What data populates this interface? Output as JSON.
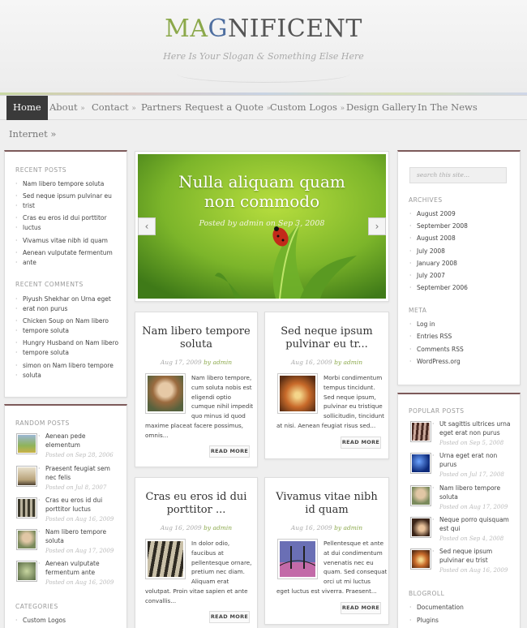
{
  "site": {
    "logo_part1": "MA",
    "logo_part2": "G",
    "logo_part3": "NIFICENT",
    "slogan": "Here Is Your Slogan & Something Else Here"
  },
  "nav": {
    "items": [
      {
        "label": "Home"
      },
      {
        "label": "About",
        "arrow": "»"
      },
      {
        "label": "Contact",
        "arrow": "»"
      },
      {
        "label": "Partners"
      },
      {
        "label": "Request a Quote",
        "arrow": "»"
      },
      {
        "label": "Custom Logos",
        "arrow": "»"
      },
      {
        "label": "Design Gallery"
      },
      {
        "label": "In The News"
      }
    ],
    "second_row": "Internet »"
  },
  "left_sidebar": {
    "recent_posts_title": "RECENT POSTS",
    "recent_posts": [
      "Nam libero tempore soluta",
      "Sed neque ipsum pulvinar eu",
      "trist",
      "Cras eu eros id dui porttitor",
      "luctus",
      "Vivamus vitae nibh id quam",
      "Aenean vulputate fermentum",
      "ante"
    ],
    "recent_comments_title": "RECENT COMMENTS",
    "recent_comments": [
      "Piyush Shekhar on Urna eget",
      "erat non purus",
      "Chicken Soup on Nam libero",
      "tempore soluta",
      "Hungry Husband on Nam libero",
      "tempore soluta",
      "simon on Nam libero tempore",
      "soluta"
    ],
    "random_posts_title": "RANDOM POSTS",
    "random_posts": [
      {
        "title1": "Aenean pede",
        "title2": "elementum",
        "date": "Posted on Sep 28, 2006"
      },
      {
        "title1": "Praesent feugiat sem",
        "title2": "nec felis",
        "date": "Posted on Jul 8, 2007"
      },
      {
        "title1": "Cras eu eros id dui",
        "title2": "porttitor luctus",
        "date": "Posted on Aug 16, 2009"
      },
      {
        "title1": "Nam libero tempore",
        "title2": "soluta",
        "date": "Posted on Aug 17, 2009"
      },
      {
        "title1": "Aenean vulputate",
        "title2": "fermentum ante",
        "date": "Posted on Aug 16, 2009"
      }
    ],
    "categories_title": "CATEGORIES",
    "categories": [
      "Custom Logos"
    ]
  },
  "featured": {
    "title_line1": "Nulla aliquam quam",
    "title_line2": "non commodo",
    "meta": "Posted by admin on Sep 3, 2008",
    "prev": "‹",
    "next": "›"
  },
  "posts": [
    {
      "title1": "Nam libero tempore",
      "title2": "soluta",
      "date": "Aug 17, 2009",
      "by": "by",
      "author": "admin",
      "text": [
        "Nam libero tempore,",
        "cum soluta nobis est",
        "eligendi optio",
        "cumque nihil impedit",
        "quo minus id quod"
      ],
      "text_wide": [
        "maxime placeat facere possimus,",
        "omnis..."
      ],
      "more": "READ MORE"
    },
    {
      "title1": "Sed neque ipsum",
      "title2": "pulvinar eu tr...",
      "date": "Aug 16, 2009",
      "by": "by",
      "author": "admin",
      "text": [
        "Morbi condimentum",
        "tempus tincidunt.",
        "Sed neque ipsum,",
        "pulvinar eu tristique",
        "sollicitudin, tincidunt"
      ],
      "text_wide": [
        "at nisi. Aenean feugiat risus sed..."
      ],
      "more": "READ MORE"
    },
    {
      "title1": "Cras eu eros id dui",
      "title2": "porttitor ...",
      "date": "Aug 16, 2009",
      "by": "by",
      "author": "admin",
      "text": [
        "In dolor odio,",
        "faucibus at",
        "pellentesque ornare,",
        "pretium nec diam.",
        "Aliquam erat"
      ],
      "text_wide": [
        "volutpat. Proin vitae sapien et ante",
        "convallis..."
      ],
      "more": "READ MORE"
    },
    {
      "title1": "Vivamus vitae nibh",
      "title2": "id quam",
      "date": "Aug 16, 2009",
      "by": "by",
      "author": "admin",
      "text": [
        "Pellentesque et ante",
        "at dui condimentum",
        "venenatis nec eu",
        "quam. Sed consequat",
        "orci ut mi luctus"
      ],
      "text_wide": [
        "eget luctus est viverra. Praesent..."
      ],
      "more": "READ MORE"
    }
  ],
  "right_sidebar": {
    "search_placeholder": "search this site...",
    "archives_title": "ARCHIVES",
    "archives": [
      "August 2009",
      "September 2008",
      "August 2008",
      "July 2008",
      "January 2008",
      "July 2007",
      "September 2006"
    ],
    "meta_title": "META",
    "meta": [
      "Log in",
      "Entries RSS",
      "Comments RSS",
      "WordPress.org"
    ],
    "popular_title": "POPULAR POSTS",
    "popular": [
      {
        "title1": "Ut sagittis ultrices urna",
        "title2": "eget erat non purus",
        "date": "Posted on Sep 5, 2008"
      },
      {
        "title1": "Urna eget erat non",
        "title2": "purus",
        "date": "Posted on Jul 17, 2008"
      },
      {
        "title1": "Nam libero tempore",
        "title2": "soluta",
        "date": "Posted on Aug 17, 2009"
      },
      {
        "title1": "Neque porro quisquam",
        "title2": "est qui",
        "date": "Posted on Sep 4, 2008"
      },
      {
        "title1": "Sed neque ipsum",
        "title2": "pulvinar eu trist",
        "date": "Posted on Aug 16, 2009"
      }
    ],
    "blogroll_title": "BLOGROLL",
    "blogroll": [
      "Documentation",
      "Plugins"
    ]
  }
}
